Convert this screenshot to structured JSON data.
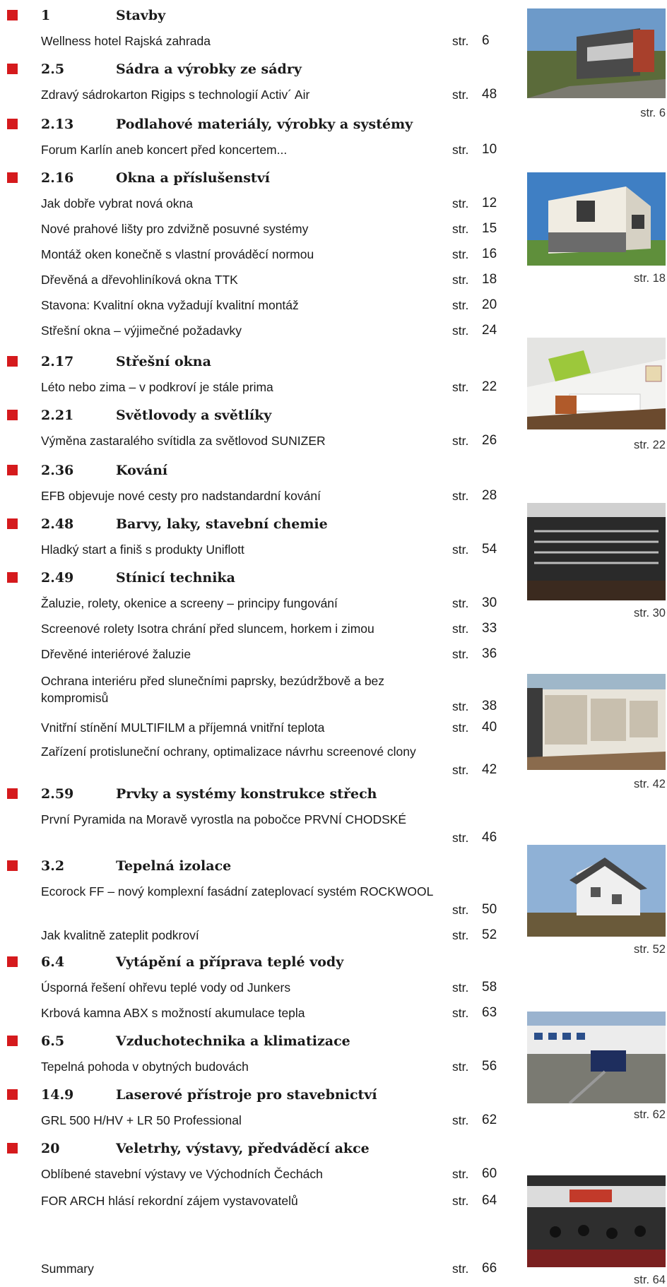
{
  "sections": [
    {
      "number": "1",
      "title": "Stavby",
      "entries": [
        {
          "title": "Wellness hotel Rajská zahrada",
          "page": "6"
        }
      ]
    },
    {
      "number": "2.5",
      "title": "Sádra a výrobky ze sádry",
      "entries": [
        {
          "title": "Zdravý sádrokarton Rigips s technologií Activ´ Air",
          "page": "48"
        }
      ]
    },
    {
      "number": "2.13",
      "title": "Podlahové materiály, výrobky a systémy",
      "entries": [
        {
          "title": "Forum Karlín aneb koncert před koncertem...",
          "page": "10"
        }
      ]
    },
    {
      "number": "2.16",
      "title": "Okna a příslušenství",
      "entries": [
        {
          "title": "Jak dobře vybrat nová okna",
          "page": "12"
        },
        {
          "title": "Nové prahové lišty pro zdvižně posuvné systémy",
          "page": "15"
        },
        {
          "title": "Montáž oken konečně s vlastní prováděcí normou",
          "page": "16"
        },
        {
          "title": "Dřevěná a dřevohliníková okna TTK",
          "page": "18"
        },
        {
          "title": "Stavona: Kvalitní okna vyžadují kvalitní montáž",
          "page": "20"
        },
        {
          "title": "Střešní okna – výjimečné požadavky",
          "page": "24"
        }
      ]
    },
    {
      "number": "2.17",
      "title": "Střešní okna",
      "entries": [
        {
          "title": "Léto nebo zima – v podkroví je stále prima",
          "page": "22"
        }
      ]
    },
    {
      "number": "2.21",
      "title": "Světlovody a světlíky",
      "entries": [
        {
          "title": "Výměna zastaralého svítidla za světlovod SUNIZER",
          "page": "26"
        }
      ]
    },
    {
      "number": "2.36",
      "title": "Kování",
      "entries": [
        {
          "title": "EFB objevuje nové cesty pro nadstandardní kování",
          "page": "28"
        }
      ]
    },
    {
      "number": "2.48",
      "title": "Barvy, laky, stavební chemie",
      "entries": [
        {
          "title": "Hladký start a finiš s produkty Uniflott",
          "page": "54"
        }
      ]
    },
    {
      "number": "2.49",
      "title": "Stínicí technika",
      "entries": [
        {
          "title": "Žaluzie, rolety, okenice a screeny – principy fungování",
          "page": "30"
        },
        {
          "title": "Screenové rolety Isotra chrání před sluncem, horkem i zimou",
          "page": "33"
        },
        {
          "title": "Dřevěné interiérové žaluzie",
          "page": "36"
        },
        {
          "title": "Ochrana interiéru před slunečními paprsky, bezúdržbově a bez kompromisů",
          "page": "38"
        },
        {
          "title": "Vnitřní stínění MULTIFILM a příjemná vnitřní teplota",
          "page": "40"
        },
        {
          "title": "Zařízení protisluneční ochrany, optimalizace návrhu screenové clony",
          "page": "42"
        }
      ]
    },
    {
      "number": "2.59",
      "title": "Prvky a systémy konstrukce střech",
      "entries": [
        {
          "title": "První Pyramida na Moravě vyrostla na pobočce PRVNÍ CHODSKÉ",
          "page": "46"
        }
      ]
    },
    {
      "number": "3.2",
      "title": "Tepelná izolace",
      "entries": [
        {
          "title": "Ecorock FF – nový komplexní fasádní zateplovací systém ROCKWOOL",
          "page": "50"
        },
        {
          "title": "Jak kvalitně zateplit podkroví",
          "page": "52"
        }
      ]
    },
    {
      "number": "6.4",
      "title": "Vytápění a příprava teplé vody",
      "entries": [
        {
          "title": "Úsporná řešení ohřevu teplé vody od Junkers",
          "page": "58"
        },
        {
          "title": "Krbová kamna ABX s možností akumulace tepla",
          "page": "63"
        }
      ]
    },
    {
      "number": "6.5",
      "title": "Vzduchotechnika a klimatizace",
      "entries": [
        {
          "title": "Tepelná pohoda v obytných budovách",
          "page": "56"
        }
      ]
    },
    {
      "number": "14.9",
      "title": "Laserové přístroje pro stavebnictví",
      "entries": [
        {
          "title": "GRL 500 H/HV + LR 50 Professional",
          "page": "62"
        }
      ]
    },
    {
      "number": "20",
      "title": "Veletrhy, výstavy, předváděcí akce",
      "entries": [
        {
          "title": "Oblíbené stavební výstavy ve Východních Čechách",
          "page": "60"
        },
        {
          "title": "FOR ARCH hlásí rekordní zájem vystavovatelů",
          "page": "64"
        }
      ]
    }
  ],
  "summary": {
    "title": "Summary",
    "page": "66"
  },
  "str_label": "str.",
  "photos": [
    {
      "caption": "str. 6",
      "icon": "modern-hotel-photo"
    },
    {
      "caption": "str. 18",
      "icon": "white-house-photo"
    },
    {
      "caption": "str. 22",
      "icon": "attic-bedroom-photo"
    },
    {
      "caption": "str. 30",
      "icon": "interior-blinds-photo"
    },
    {
      "caption": "str. 42",
      "icon": "exterior-screens-photo"
    },
    {
      "caption": "str. 52",
      "icon": "family-house-photo"
    },
    {
      "caption": "str. 62",
      "icon": "laser-level-photo"
    },
    {
      "caption": "str. 64",
      "icon": "exhibition-hall-photo"
    }
  ],
  "colors": {
    "bullet": "#d51a1d",
    "text": "#1a1a1a"
  }
}
